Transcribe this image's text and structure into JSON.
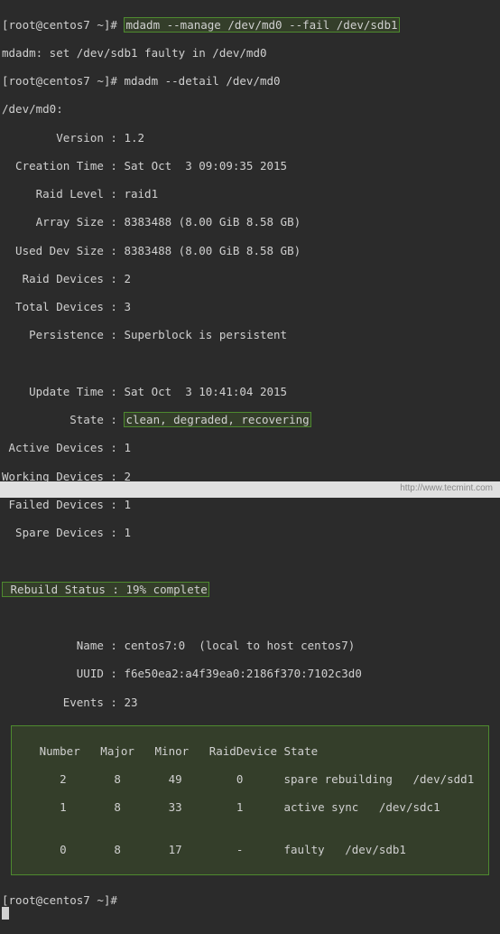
{
  "prompt": "[root@centos7 ~]# ",
  "cmd1": "mdadm --manage /dev/md0 --fail /dev/sdb1",
  "out1": "mdadm: set /dev/sdb1 faulty in /dev/md0",
  "cmd2": "mdadm --detail /dev/md0",
  "device_line": "/dev/md0:",
  "detail": {
    "version": "        Version : 1.2",
    "creation_time": "  Creation Time : Sat Oct  3 09:09:35 2015",
    "raid_level": "     Raid Level : raid1",
    "array_size": "     Array Size : 8383488 (8.00 GiB 8.58 GB)",
    "used_dev_size": "  Used Dev Size : 8383488 (8.00 GiB 8.58 GB)",
    "raid_devices": "   Raid Devices : 2",
    "total_devices": "  Total Devices : 3",
    "persistence": "    Persistence : Superblock is persistent",
    "update_time": "    Update Time : Sat Oct  3 10:41:04 2015",
    "state_label": "          State : ",
    "state_value": "clean, degraded, recovering",
    "active_devices": " Active Devices : 1",
    "working_devices": "Working Devices : 2",
    "failed_devices": " Failed Devices : 1",
    "spare_devices": "  Spare Devices : 1",
    "rebuild_status": " Rebuild Status : 19% complete",
    "name": "           Name : centos7:0  (local to host centos7)",
    "uuid": "           UUID : f6e50ea2:a4f39ea0:2186f370:7102c3d0",
    "events": "         Events : 23"
  },
  "table": {
    "header": "   Number   Major   Minor   RaidDevice State",
    "row1": "      2       8       49        0      spare rebuilding   /dev/sdd1",
    "row2": "      1       8       33        1      active sync   /dev/sdc1",
    "blank": "",
    "row3": "      0       8       17        -      faulty   /dev/sdb1"
  },
  "watermark": "http://www.tecmint.com"
}
